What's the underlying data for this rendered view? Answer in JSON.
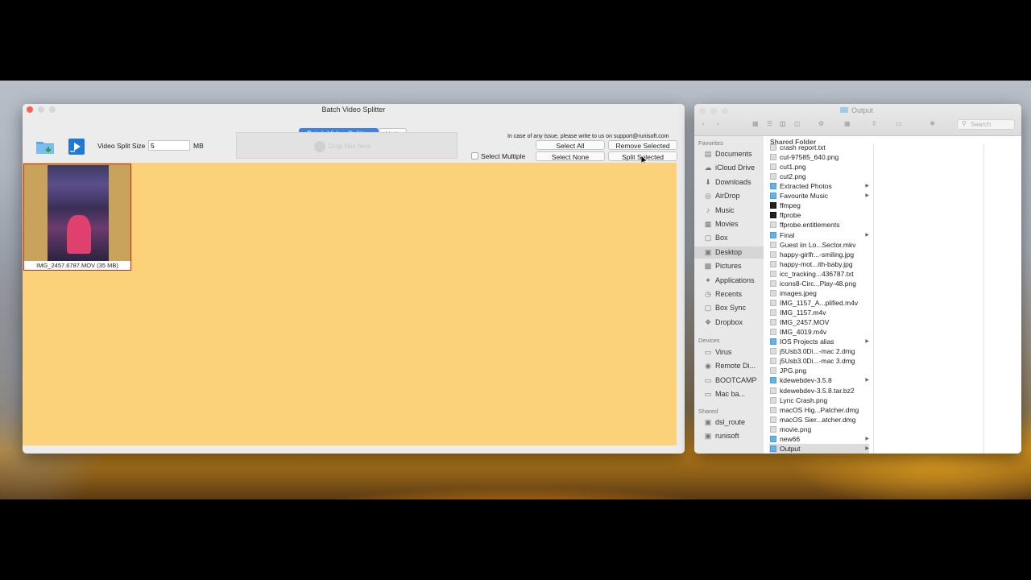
{
  "app": {
    "title": "Batch Video Splitter",
    "tabs": {
      "active": "Batch Video Splitter",
      "help": "Help"
    },
    "split_size_label": "Video Split Size",
    "split_size_value": "5",
    "split_size_unit": "MB",
    "drop_text": "Drop files here",
    "support_text": "In case of any issue, please write to us on support@runisoft.com",
    "buttons": {
      "select_all": "Select All",
      "remove_selected": "Remove Selected",
      "select_multiple": "Select Multiple",
      "select_none": "Select None",
      "split_selected": "Split Selected"
    },
    "files": [
      {
        "caption": "IMG_2457.6787.MOV (35 MB)"
      }
    ],
    "colors": {
      "content_bg": "#fbd27a",
      "accent": "#3b82e8",
      "selection_border": "#dd2211"
    }
  },
  "finder": {
    "title": "Output",
    "search_placeholder": "Search",
    "column_header": "Shared Folder",
    "sidebar": {
      "favorites_label": "Favorites",
      "favorites": [
        {
          "label": "Documents",
          "icon": "document-icon"
        },
        {
          "label": "iCloud Drive",
          "icon": "cloud-icon"
        },
        {
          "label": "Downloads",
          "icon": "download-icon"
        },
        {
          "label": "AirDrop",
          "icon": "airdrop-icon"
        },
        {
          "label": "Music",
          "icon": "music-icon"
        },
        {
          "label": "Movies",
          "icon": "film-icon"
        },
        {
          "label": "Box",
          "icon": "folder-icon"
        },
        {
          "label": "Desktop",
          "icon": "desktop-icon"
        },
        {
          "label": "Pictures",
          "icon": "camera-icon"
        },
        {
          "label": "Applications",
          "icon": "applications-icon"
        },
        {
          "label": "Recents",
          "icon": "clock-icon"
        },
        {
          "label": "Box Sync",
          "icon": "folder-icon"
        },
        {
          "label": "Dropbox",
          "icon": "dropbox-icon"
        }
      ],
      "devices_label": "Devices",
      "devices": [
        {
          "label": "Virus",
          "icon": "disk-icon"
        },
        {
          "label": "Remote Di...",
          "icon": "disc-icon"
        },
        {
          "label": "BOOTCAMP",
          "icon": "disk-icon"
        },
        {
          "label": "Mac ba...",
          "icon": "disk-icon"
        }
      ],
      "shared_label": "Shared",
      "shared": [
        {
          "label": "dsl_route",
          "icon": "monitor-icon"
        },
        {
          "label": "runisoft",
          "icon": "monitor-icon"
        }
      ]
    },
    "files": [
      {
        "name": "crash report.txt",
        "kind": "doc"
      },
      {
        "name": "cut-97585_640.png",
        "kind": "doc"
      },
      {
        "name": "cut1.png",
        "kind": "doc"
      },
      {
        "name": "cut2.png",
        "kind": "doc"
      },
      {
        "name": "Extracted Photos",
        "kind": "folder"
      },
      {
        "name": "Favourite Music",
        "kind": "folder"
      },
      {
        "name": "ffmpeg",
        "kind": "exe"
      },
      {
        "name": "ffprobe",
        "kind": "exe"
      },
      {
        "name": "ffprobe.entitlements",
        "kind": "doc"
      },
      {
        "name": "Final",
        "kind": "folder"
      },
      {
        "name": "Guest iin Lo...Sector.mkv",
        "kind": "doc"
      },
      {
        "name": "happy-girlfr...-smiling.jpg",
        "kind": "doc"
      },
      {
        "name": "happy-mot...ith-baby.jpg",
        "kind": "doc"
      },
      {
        "name": "icc_tracking...436787.txt",
        "kind": "doc"
      },
      {
        "name": "icons8-Circ...Play-48.png",
        "kind": "doc"
      },
      {
        "name": "images.jpeg",
        "kind": "doc"
      },
      {
        "name": "IMG_1157_A...plified.m4v",
        "kind": "doc"
      },
      {
        "name": "IMG_1157.m4v",
        "kind": "doc"
      },
      {
        "name": "IMG_2457.MOV",
        "kind": "doc"
      },
      {
        "name": "IMG_4019.m4v",
        "kind": "doc"
      },
      {
        "name": "IOS Projects alias",
        "kind": "folder"
      },
      {
        "name": "j5Usb3.0Di...-mac 2.dmg",
        "kind": "doc"
      },
      {
        "name": "j5Usb3.0Di...-mac 3.dmg",
        "kind": "doc"
      },
      {
        "name": "JPG.png",
        "kind": "doc"
      },
      {
        "name": "kdewebdev-3.5.8",
        "kind": "folder"
      },
      {
        "name": "kdewebdev-3.5.8.tar.bz2",
        "kind": "doc"
      },
      {
        "name": "Lync Crash.png",
        "kind": "doc"
      },
      {
        "name": "macOS Hig...Patcher.dmg",
        "kind": "doc"
      },
      {
        "name": "macOS Sier...atcher.dmg",
        "kind": "doc"
      },
      {
        "name": "movie.png",
        "kind": "doc"
      },
      {
        "name": "new66",
        "kind": "folder"
      },
      {
        "name": "Output",
        "kind": "folder"
      }
    ]
  }
}
